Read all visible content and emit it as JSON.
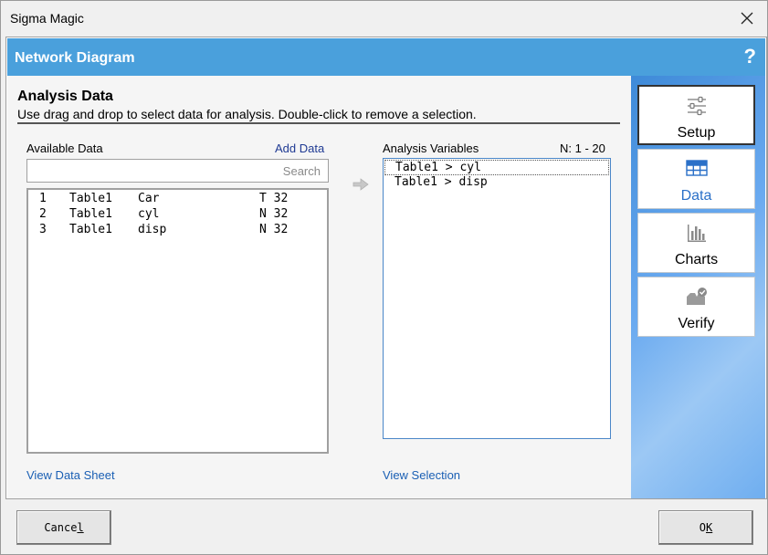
{
  "window": {
    "title": "Sigma Magic"
  },
  "header": {
    "title": "Network Diagram",
    "help": "?"
  },
  "section": {
    "title": "Analysis Data",
    "description": "Use drag and drop to select data for analysis. Double-click to remove a selection."
  },
  "available": {
    "label": "Available Data",
    "add_link": "Add Data",
    "search_placeholder": "Search",
    "rows": [
      {
        "num": "1",
        "table": "Table1",
        "name": "Car",
        "type": "T 32"
      },
      {
        "num": "2",
        "table": "Table1",
        "name": "cyl",
        "type": "N 32"
      },
      {
        "num": "3",
        "table": "Table1",
        "name": "disp",
        "type": "N 32"
      }
    ],
    "view_link": "View Data Sheet"
  },
  "analysis": {
    "label": "Analysis Variables",
    "range": "N: 1 - 20",
    "items": [
      "Table1 > cyl",
      "Table1 > disp"
    ],
    "view_link": "View Selection"
  },
  "nav": [
    {
      "label": "Setup",
      "icon": "sliders-icon"
    },
    {
      "label": "Data",
      "icon": "table-icon"
    },
    {
      "label": "Charts",
      "icon": "bar-chart-icon"
    },
    {
      "label": "Verify",
      "icon": "inbox-check-icon"
    }
  ],
  "buttons": {
    "cancel_pre": "Cance",
    "cancel_ul": "l",
    "ok_pre": "O",
    "ok_ul": "K"
  },
  "colors": {
    "header": "#4aa0dc",
    "link": "#1f3a93",
    "accent": "#2a70c8"
  }
}
